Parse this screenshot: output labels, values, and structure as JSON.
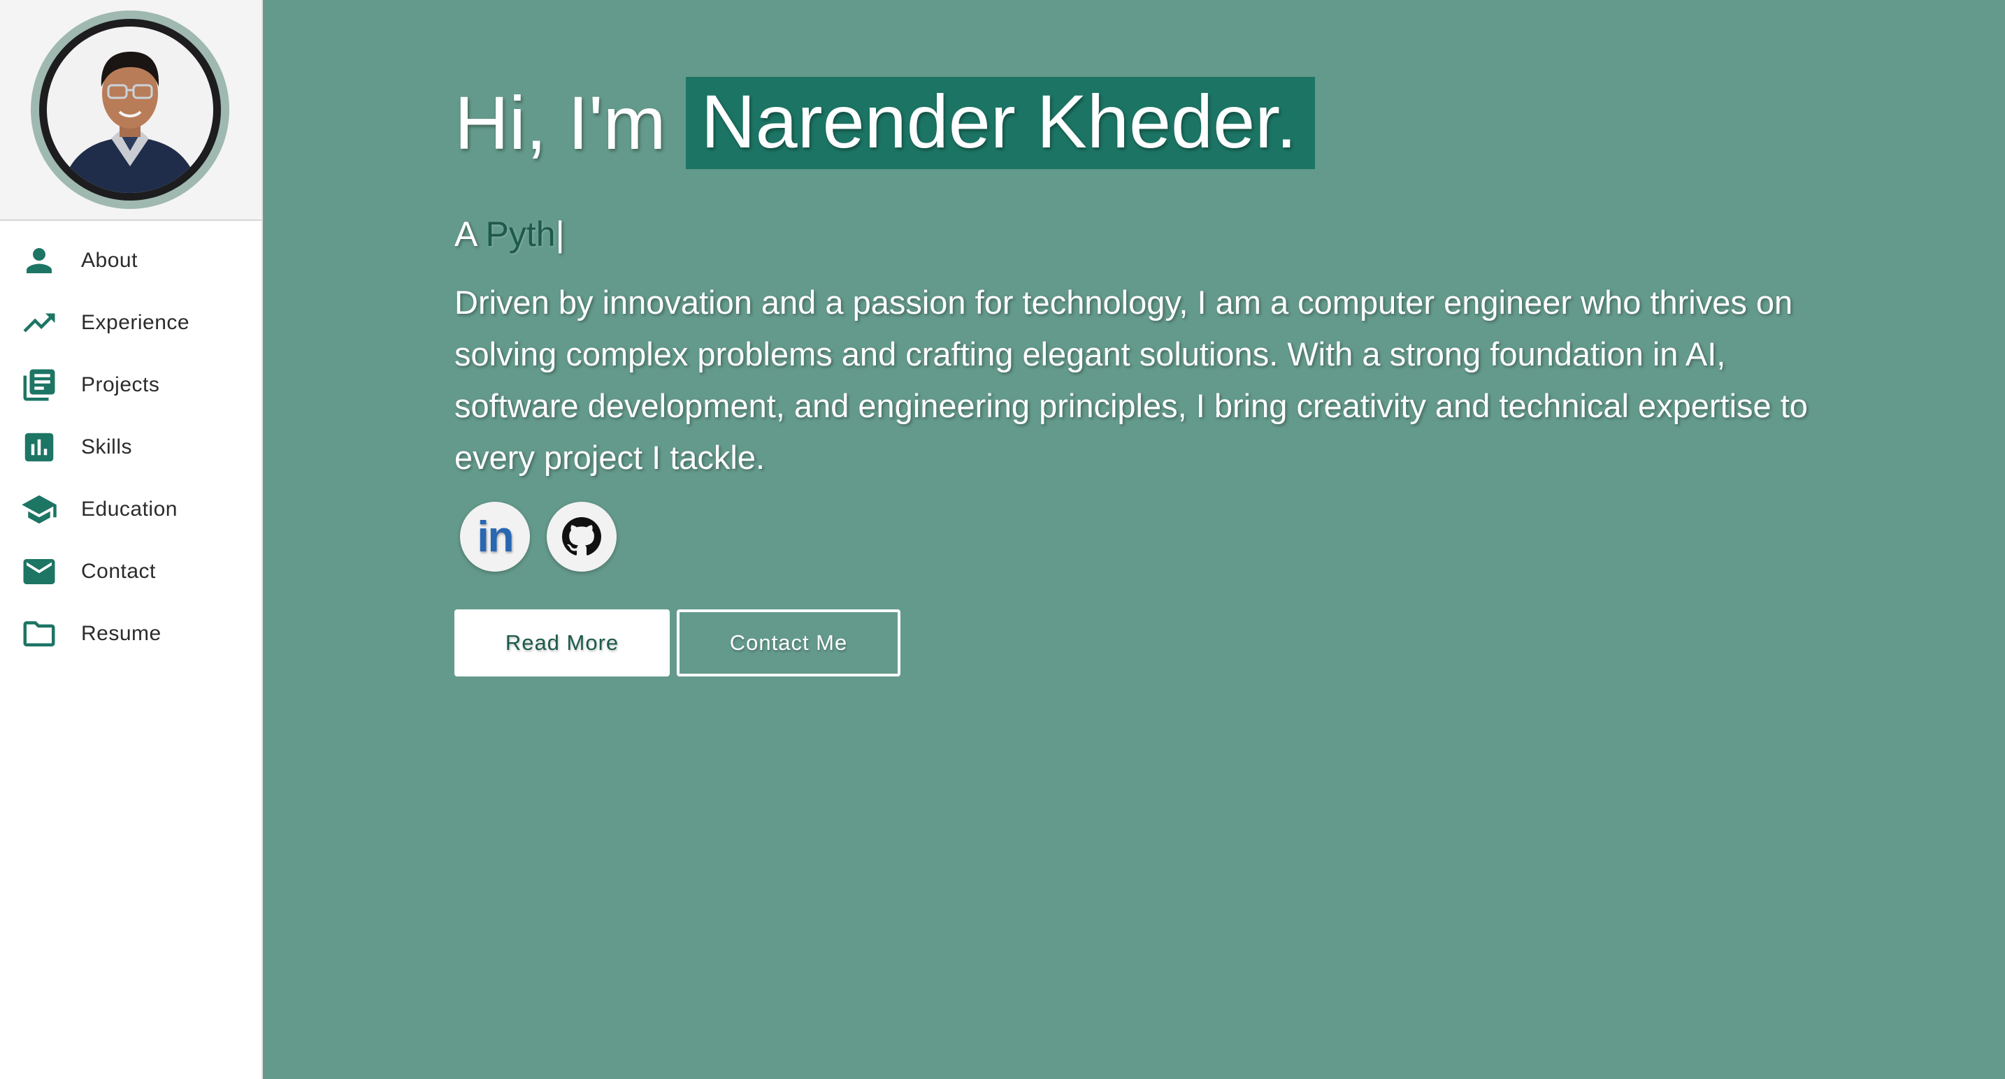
{
  "colors": {
    "accent": "#1d7564",
    "background": "#649a8b",
    "sidebar": "#ffffff",
    "linkedin": "#2867b2"
  },
  "sidebar": {
    "avatar_alt": "profile-photo",
    "items": [
      {
        "label": "About",
        "icon": "person-icon"
      },
      {
        "label": "Experience",
        "icon": "trending-up-icon"
      },
      {
        "label": "Projects",
        "icon": "library-books-icon"
      },
      {
        "label": "Skills",
        "icon": "bar-chart-icon"
      },
      {
        "label": "Education",
        "icon": "graduation-cap-icon"
      },
      {
        "label": "Contact",
        "icon": "mail-icon"
      },
      {
        "label": "Resume",
        "icon": "folder-icon"
      }
    ]
  },
  "hero": {
    "greeting": "Hi, I'm",
    "name": "Narender Kheder.",
    "subtitle_prefix": "A",
    "subtitle_typed": "Pyth",
    "cursor": "|",
    "bio": "Driven by innovation and a passion for technology, I am a computer engineer who thrives on solving complex problems and crafting elegant solutions. With a strong foundation in AI, software development, and engineering principles, I bring creativity and technical expertise to every project I tackle.",
    "socials": [
      {
        "name": "LinkedIn",
        "icon": "linkedin-icon",
        "glyph": "in"
      },
      {
        "name": "GitHub",
        "icon": "github-icon"
      }
    ],
    "read_more_label": "Read More",
    "contact_me_label": "Contact Me"
  }
}
